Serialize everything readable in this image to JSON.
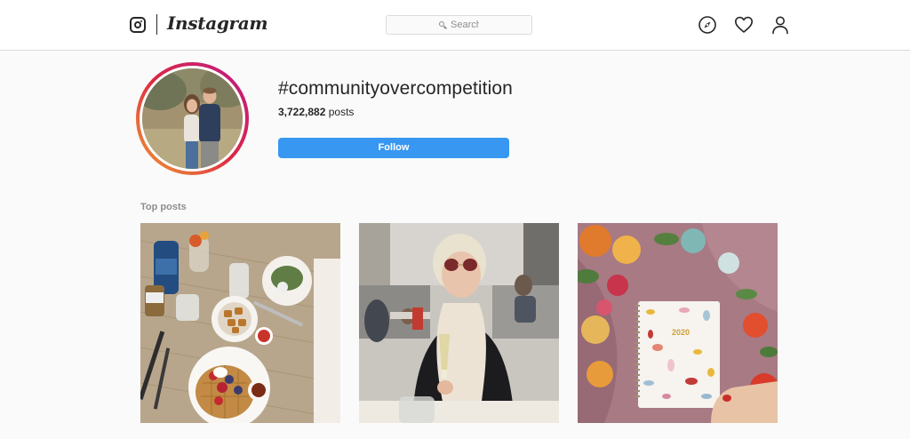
{
  "app": {
    "wordmark": "Instagram",
    "icons": {
      "logo": "instagram-glyph-icon",
      "explore": "compass-icon",
      "activity": "heart-icon",
      "profile": "person-icon",
      "search": "magnifier-icon"
    }
  },
  "search": {
    "placeholder": "Search"
  },
  "hashtag": {
    "title": "#communityovercompetition",
    "post_count": "3,722,882",
    "post_count_suffix": " posts",
    "follow_label": "Follow"
  },
  "top_posts": {
    "label": "Top posts",
    "posts": [
      {
        "subject": "brunch table with waffles, potatoes and salad"
      },
      {
        "subject": "woman in sunglasses with champagne glass"
      },
      {
        "subject": "2020 planner with flowers",
        "printed_text": "2020"
      }
    ]
  },
  "colors": {
    "accent": "#3897f0",
    "background": "#fafafa",
    "text": "#262626",
    "muted": "#8e8e8e",
    "border": "#dbdbdb"
  }
}
